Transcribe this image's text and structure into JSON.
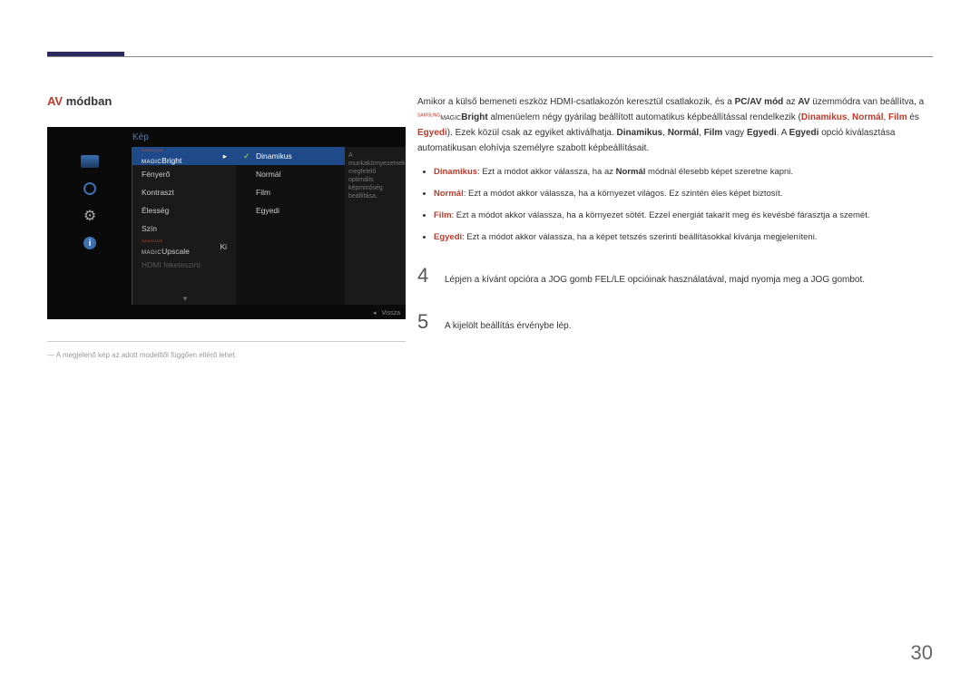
{
  "page_number": "30",
  "section_title": {
    "highlight": "AV",
    "rest": " módban"
  },
  "footnote": "― A megjelenő kép az adott modelltől függően eltérő lehet.",
  "osd": {
    "title": "Kép",
    "menu": {
      "bright_prefix_sup": "SAMSUNG",
      "bright_prefix": "MAGIC",
      "bright_label": "Bright",
      "fenyero": "Fényerő",
      "kontraszt": "Kontraszt",
      "elesseg": "Élesség",
      "szin": "Szín",
      "upscale_prefix_sup": "SAMSUNG",
      "upscale_prefix": "MAGIC",
      "upscale_label": "Upscale",
      "upscale_value": "Ki",
      "hdmi": "HDMI feketeszint"
    },
    "submenu": {
      "dinamikus": "Dinamikus",
      "normal": "Normál",
      "film": "Film",
      "egyedi": "Egyedi"
    },
    "description": "A munkakörnyezetnek megfelelő optimális képminőség beállítása.",
    "footer_back": "Vissza"
  },
  "content": {
    "intro_1a": "Amikor a külső bemeneti eszköz HDMI-csatlakozón keresztül csatlakozik, és a ",
    "intro_pcav": "PC/AV mód",
    "intro_1b": " az ",
    "intro_av": "AV",
    "intro_1c": " üzemmódra van beállítva, a ",
    "intro_bright": "Bright",
    "intro_2a": " almenüelem négy gyárilag beállított automatikus képbeállítással rendelkezik (",
    "intro_din": "Dinamikus",
    "intro_sep1": ", ",
    "intro_nor": "Normál",
    "intro_sep2": ", ",
    "intro_film": "Film",
    "intro_2b": " és ",
    "intro_egy": "Egyedi",
    "intro_3a": "). Ezek közül csak az egyiket aktiválhatja. ",
    "intro_3din": "Dinamikus",
    "intro_3sep1": ", ",
    "intro_3nor": "Normál",
    "intro_3sep2": ", ",
    "intro_3film": "Film",
    "intro_3b": " vagy ",
    "intro_3egy": "Egyedi",
    "intro_3c": ". A ",
    "intro_3egy2": "Egyedi",
    "intro_3d": " opció kiválasztása automatikusan elohívja személyre szabott képbeállításait.",
    "bullets": {
      "b1_label": "Dinamikus",
      "b1_a": ": Ezt a módot akkor válassza, ha az ",
      "b1_norm": "Normál",
      "b1_b": " módnál élesebb képet szeretne kapni.",
      "b2_label": "Normál",
      "b2_text": ": Ezt a módot akkor válassza, ha a környezet világos. Ez szintén éles képet biztosít.",
      "b3_label": "Film",
      "b3_text": ": Ezt a módot akkor válassza, ha a környezet sötét. Ezzel energiát takarít meg és kevésbé fárasztja a szemét.",
      "b4_label": "Egyedi",
      "b4_text": ": Ezt a módot akkor válassza, ha a képet tetszés szerinti beállításokkal kívánja megjeleníteni."
    },
    "step4_num": "4",
    "step4_text": "Lépjen a kívánt opcióra a JOG gomb FEL/LE opcióinak használatával, majd nyomja meg a JOG gombot.",
    "step5_num": "5",
    "step5_text": "A kijelölt beállítás érvénybe lép."
  }
}
